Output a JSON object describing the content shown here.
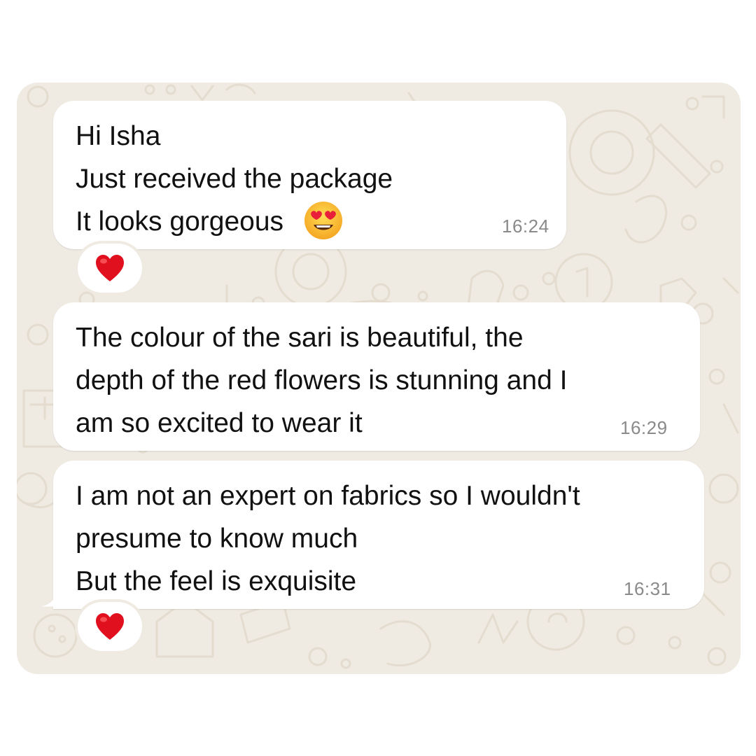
{
  "messages": [
    {
      "lines": [
        "Hi Isha",
        "Just received the package",
        "It looks gorgeous "
      ],
      "trailing_emoji": "heart-eyes-emoji-icon",
      "time": "16:24",
      "reaction": "red-heart-icon"
    },
    {
      "lines": [
        "The colour of the sari is beautiful, the",
        "depth of the red flowers is stunning and I",
        "am so excited to wear it"
      ],
      "time": "16:29"
    },
    {
      "lines": [
        "I am not an expert on fabrics so I wouldn't",
        "presume to know much",
        "But the feel is exquisite"
      ],
      "time": "16:31",
      "reaction": "red-heart-icon"
    }
  ],
  "colors": {
    "chat_background": "#efeae2",
    "bubble": "#ffffff",
    "text": "#111111",
    "timestamp": "#8a8a8a",
    "heart": "#e0101e"
  }
}
